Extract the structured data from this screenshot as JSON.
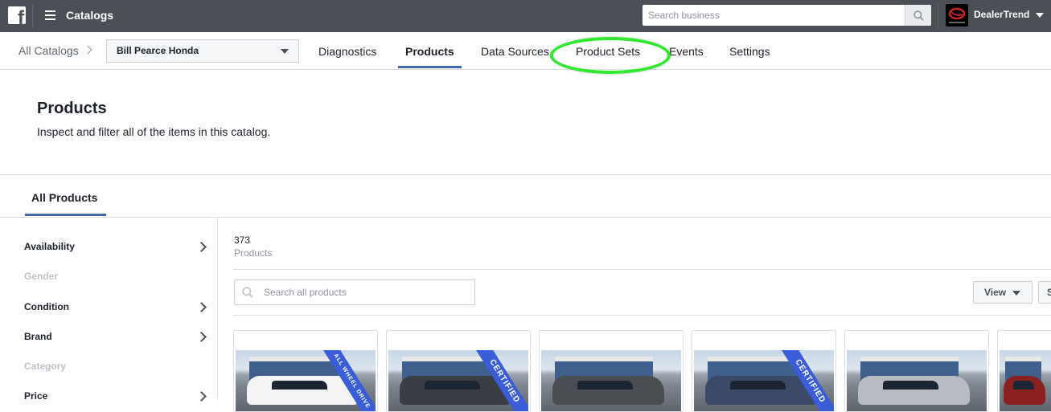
{
  "topbar": {
    "title": "Catalogs",
    "search_placeholder": "Search business",
    "business_name": "DealerTrend",
    "logo_icon": "facebook-logo",
    "menu_icon": "hamburger-icon",
    "bg_color": "#4b4f56"
  },
  "nav": {
    "breadcrumb": "All Catalogs",
    "catalog_select": "Bill Pearce Honda",
    "tabs": [
      {
        "label": "Diagnostics",
        "active": false
      },
      {
        "label": "Products",
        "active": true
      },
      {
        "label": "Data Sources",
        "active": false
      },
      {
        "label": "Product Sets",
        "active": false,
        "highlighted": true
      },
      {
        "label": "Events",
        "active": false
      },
      {
        "label": "Settings",
        "active": false
      }
    ],
    "accent_color": "#4267b2",
    "highlight_color": "#2ee82e"
  },
  "header": {
    "title": "Products",
    "subtitle": "Inspect and filter all of the items in this catalog."
  },
  "section_tabs": [
    {
      "label": "All Products",
      "active": true
    }
  ],
  "filters": [
    {
      "label": "Availability",
      "enabled": true
    },
    {
      "label": "Gender",
      "enabled": false
    },
    {
      "label": "Condition",
      "enabled": true
    },
    {
      "label": "Brand",
      "enabled": true
    },
    {
      "label": "Category",
      "enabled": false
    },
    {
      "label": "Price",
      "enabled": true
    }
  ],
  "main": {
    "count": "373",
    "count_label": "Products",
    "search_placeholder": "Search all products",
    "view_label": "View",
    "sort_label": "S"
  },
  "products": [
    {
      "banner": "ALL WHEEL DRIVE",
      "car_color": "#f4f4f4"
    },
    {
      "banner": "CERTIFIED",
      "car_color": "#3a3e44"
    },
    {
      "banner": "",
      "car_color": "#4a4d52"
    },
    {
      "banner": "CERTIFIED",
      "car_color": "#3b4a66"
    },
    {
      "banner": "",
      "car_color": "#b8bcc2"
    },
    {
      "banner": "",
      "car_color": "#8a2020"
    }
  ]
}
